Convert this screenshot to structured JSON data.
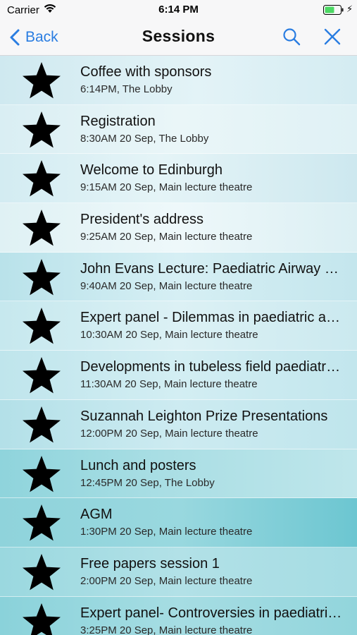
{
  "status_bar": {
    "carrier": "Carrier",
    "time": "6:14 PM"
  },
  "nav": {
    "back_label": "Back",
    "title": "Sessions",
    "accent_color": "#2a7de1"
  },
  "sessions": [
    {
      "title": "Coffee with sponsors",
      "subtitle": "6:14PM, The Lobby",
      "bg": "linear-gradient(90deg,#cfe9f0 0%,#e3f3f7 55%,#d4ecf2 100%)"
    },
    {
      "title": "Registration",
      "subtitle": "8:30AM 20 Sep, The Lobby",
      "bg": "linear-gradient(90deg,#d9eef3 0%,#eaf6f8 50%,#dff1f5 100%)"
    },
    {
      "title": "Welcome to Edinburgh",
      "subtitle": "9:15AM 20 Sep, Main lecture theatre",
      "bg": "linear-gradient(90deg,#d3ecf2 0%,#e5f4f7 45%,#cde8ef 100%)"
    },
    {
      "title": "President's address",
      "subtitle": "9:25AM 20 Sep, Main lecture theatre",
      "bg": "linear-gradient(90deg,#dff1f4 0%,#eef8fa 50%,#dbeff3 100%)"
    },
    {
      "title": "John Evans Lecture: Paediatric Airway Management",
      "subtitle": "9:40AM 20 Sep, Main lecture theatre",
      "bg": "linear-gradient(90deg,#b9e2ea 0%,#d6eff4 50%,#c4e6ed 100%)"
    },
    {
      "title": "Expert panel - Dilemmas in paediatric anaesthesia",
      "subtitle": "10:30AM 20 Sep, Main lecture theatre",
      "bg": "linear-gradient(90deg,#c6e8ee 0%,#dcf1f5 50%,#cbe9ef 100%)"
    },
    {
      "title": "Developments in tubeless field paediatric anaesthesia",
      "subtitle": "11:30AM 20 Sep, Main lecture theatre",
      "bg": "linear-gradient(90deg,#bfe5ec 0%,#d3eef3 50%,#c2e6ed 100%)"
    },
    {
      "title": "Suzannah Leighton Prize Presentations",
      "subtitle": "12:00PM 20 Sep, Main lecture theatre",
      "bg": "linear-gradient(90deg,#b3e0e8 0%,#cdebf1 50%,#bfe5ec 100%)"
    },
    {
      "title": "Lunch and posters",
      "subtitle": "12:45PM 20 Sep, The Lobby",
      "bg": "linear-gradient(90deg,#8fd4dc 0%,#a9dee4 45%,#bfe6eb 100%)"
    },
    {
      "title": "AGM",
      "subtitle": "1:30PM 20 Sep, Main lecture theatre",
      "bg": "linear-gradient(90deg,#8fd3db 0%,#99d8df 50%,#6cc6d1 100%)"
    },
    {
      "title": "Free papers session 1",
      "subtitle": "2:00PM 20 Sep, Main lecture theatre",
      "bg": "linear-gradient(90deg,#9ad8df 0%,#b2e1e7 50%,#a5dce3 100%)"
    },
    {
      "title": "Expert panel- Controversies in paediatric anaesthesia",
      "subtitle": "3:25PM 20 Sep, Main lecture theatre",
      "bg": "linear-gradient(90deg,#8ad2da 0%,#a6dde3 50%,#92d5dc 100%)"
    }
  ]
}
